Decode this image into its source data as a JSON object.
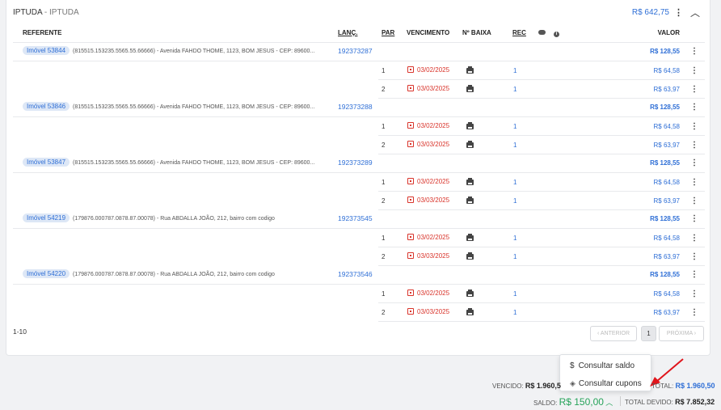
{
  "header": {
    "title": "IPTUDA",
    "separator": " - ",
    "subtitle": "IPTUDA",
    "total": "R$ 642,75"
  },
  "columns": {
    "referente": "REFERENTE",
    "lanc": "LANÇ.",
    "par": "PAR",
    "vencimento": "VENCIMENTO",
    "baixa": "Nº BAIXA",
    "rec": "REC",
    "valor": "VALOR"
  },
  "groups": [
    {
      "imovel": "Imóvel 53844",
      "address": "(815515.153235.5565.55.66666) - Avenida FAHDO THOME, 1123, BOM JESUS - CEP: 89600...",
      "lanc": "192373287",
      "total": "R$ 128,55",
      "parcels": [
        {
          "par": "1",
          "venc": "03/02/2025",
          "rec": "1",
          "valor": "R$ 64,58"
        },
        {
          "par": "2",
          "venc": "03/03/2025",
          "rec": "1",
          "valor": "R$ 63,97"
        }
      ]
    },
    {
      "imovel": "Imóvel 53846",
      "address": "(815515.153235.5565.55.66666) - Avenida FAHDO THOME, 1123, BOM JESUS - CEP: 89600...",
      "lanc": "192373288",
      "total": "R$ 128,55",
      "parcels": [
        {
          "par": "1",
          "venc": "03/02/2025",
          "rec": "1",
          "valor": "R$ 64,58"
        },
        {
          "par": "2",
          "venc": "03/03/2025",
          "rec": "1",
          "valor": "R$ 63,97"
        }
      ]
    },
    {
      "imovel": "Imóvel 53847",
      "address": "(815515.153235.5565.55.66666) - Avenida FAHDO THOME, 1123, BOM JESUS - CEP: 89600...",
      "lanc": "192373289",
      "total": "R$ 128,55",
      "parcels": [
        {
          "par": "1",
          "venc": "03/02/2025",
          "rec": "1",
          "valor": "R$ 64,58"
        },
        {
          "par": "2",
          "venc": "03/03/2025",
          "rec": "1",
          "valor": "R$ 63,97"
        }
      ]
    },
    {
      "imovel": "Imóvel 54219",
      "address": "(179876.000787.0878.87.00078) - Rua ABDALLA JOÃO, 212, bairro com codigo",
      "lanc": "192373545",
      "total": "R$ 128,55",
      "parcels": [
        {
          "par": "1",
          "venc": "03/02/2025",
          "rec": "1",
          "valor": "R$ 64,58"
        },
        {
          "par": "2",
          "venc": "03/03/2025",
          "rec": "1",
          "valor": "R$ 63,97"
        }
      ]
    },
    {
      "imovel": "Imóvel 54220",
      "address": "(179876.000787.0878.87.00078) - Rua ABDALLA JOÃO, 212, bairro com codigo",
      "lanc": "192373546",
      "total": "R$ 128,55",
      "parcels": [
        {
          "par": "1",
          "venc": "03/02/2025",
          "rec": "1",
          "valor": "R$ 64,58"
        },
        {
          "par": "2",
          "venc": "03/03/2025",
          "rec": "1",
          "valor": "R$ 63,97"
        }
      ]
    }
  ],
  "pagination": {
    "info": "1-10",
    "prev": "‹ ANTERIOR",
    "page": "1",
    "next": "PRÓXIMA ›"
  },
  "popup": {
    "saldo_icon": "dollar-icon",
    "saldo": "Consultar saldo",
    "cupons_icon": "ticket-icon",
    "cupons": "Consultar cupons"
  },
  "footer": {
    "vencido_label": "VENCIDO:",
    "vencido_value": "R$ 1.960,5",
    "total_label": "TOTAL:",
    "total_value": "R$ 1.960,50",
    "saldo_label": "SALDO:",
    "saldo_value": "R$ 150,00",
    "total_devido_label": "TOTAL DEVIDO:",
    "total_devido_value": "R$ 7.852,32"
  },
  "colors": {
    "accent": "#2f6fd6",
    "date": "#d9342b",
    "saldo": "#27a35a",
    "arrow": "#e0141b"
  }
}
